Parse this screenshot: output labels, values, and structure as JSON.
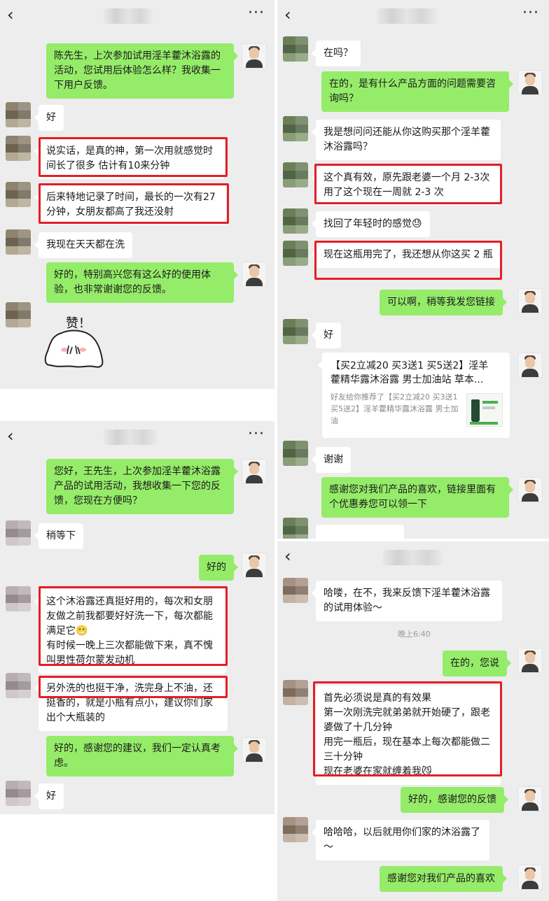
{
  "common": {
    "back_icon": "‹",
    "more_icon": "···"
  },
  "panel1": {
    "messages": [
      {
        "side": "right",
        "text": "陈先生，上次参加试用淫羊藿沐浴露的活动，您试用后体验怎么样？我收集一下用户反馈。"
      },
      {
        "side": "left",
        "text": "好"
      },
      {
        "side": "left",
        "text": "说实话，是真的神，第一次用就感觉时间长了很多 估计有10来分钟"
      },
      {
        "side": "left",
        "text": "后来特地记录了时间，最长的一次有27分钟，女朋友都高了我还没射"
      },
      {
        "side": "left",
        "text": "我现在天天都在洗"
      },
      {
        "side": "right",
        "text": "好的，特别高兴您有这么好的使用体验，也非常谢谢您的反馈。"
      }
    ],
    "sticker_text": "赞！"
  },
  "panel2": {
    "messages": [
      {
        "side": "right",
        "text": "您好，王先生，上次参加淫羊藿沐浴露产品的试用活动，我想收集一下您的反馈，您现在方便吗？"
      },
      {
        "side": "left",
        "text": "稍等下"
      },
      {
        "side": "right",
        "text": "好的"
      },
      {
        "side": "left",
        "text": "这个沐浴露还真挺好用的，每次和女朋友做之前我都要好好洗一下，每次都能满足它😬\n有时候一晚上三次都能做下来，真不愧叫男性荷尔蒙发动机"
      },
      {
        "side": "left",
        "text": "另外洗的也挺干净，洗完身上不油，还挺香的，就是小瓶有点小，建议你们家出个大瓶装的"
      },
      {
        "side": "right",
        "text": "好的，感谢您的建议，我们一定认真考虑。"
      },
      {
        "side": "left",
        "text": "好"
      }
    ]
  },
  "panel3": {
    "messages": [
      {
        "side": "left",
        "text": "在吗？"
      },
      {
        "side": "right",
        "text": "在的，是有什么产品方面的问题需要咨询吗？"
      },
      {
        "side": "left",
        "text": "我是想问问还能从你这购买那个淫羊藿沐浴露吗？"
      },
      {
        "side": "left",
        "text": "这个真有效，原先跟老婆一个月 2-3次 用了这个现在一周就 2-3 次"
      },
      {
        "side": "left",
        "text": "找回了年轻时的感觉😓"
      },
      {
        "side": "left",
        "text": "现在这瓶用完了，我还想从你这买 2 瓶"
      },
      {
        "side": "right",
        "text": "可以啊，稍等我发您链接"
      },
      {
        "side": "left",
        "text": "好"
      },
      {
        "side": "left",
        "text": "谢谢"
      },
      {
        "side": "right",
        "text": "感谢您对我们产品的喜欢，链接里面有个优惠券您可以领一下"
      }
    ],
    "link_card": {
      "title": "【买2立减20 买3送1 买5送2】淫羊藿精华露沐浴露 男士加油站 草本...",
      "desc": "好友给你推荐了【买2立减20 买3送1 买5送2】淫羊藿精华露沐浴露 男士加油"
    }
  },
  "panel4": {
    "messages": [
      {
        "side": "left",
        "text": "哈喽，在不，我来反馈下淫羊藿沐浴露的试用体验～"
      },
      {
        "side": "right",
        "text": "在的，您说"
      },
      {
        "side": "left",
        "text": "首先必须说是真的有效果\n第一次刚洗完就弟弟就开始硬了，跟老婆做了十几分钟\n用完一瓶后，现在基本上每次都能做二三十分钟\n现在老婆在家就缠着我😼"
      },
      {
        "side": "right",
        "text": "好的，感谢您的反馈"
      },
      {
        "side": "left",
        "text": "哈哈哈，以后就用你们家的沐浴露了～"
      },
      {
        "side": "right",
        "text": "感谢您对我们产品的喜欢"
      }
    ],
    "timestamp": "晚上6:40"
  }
}
